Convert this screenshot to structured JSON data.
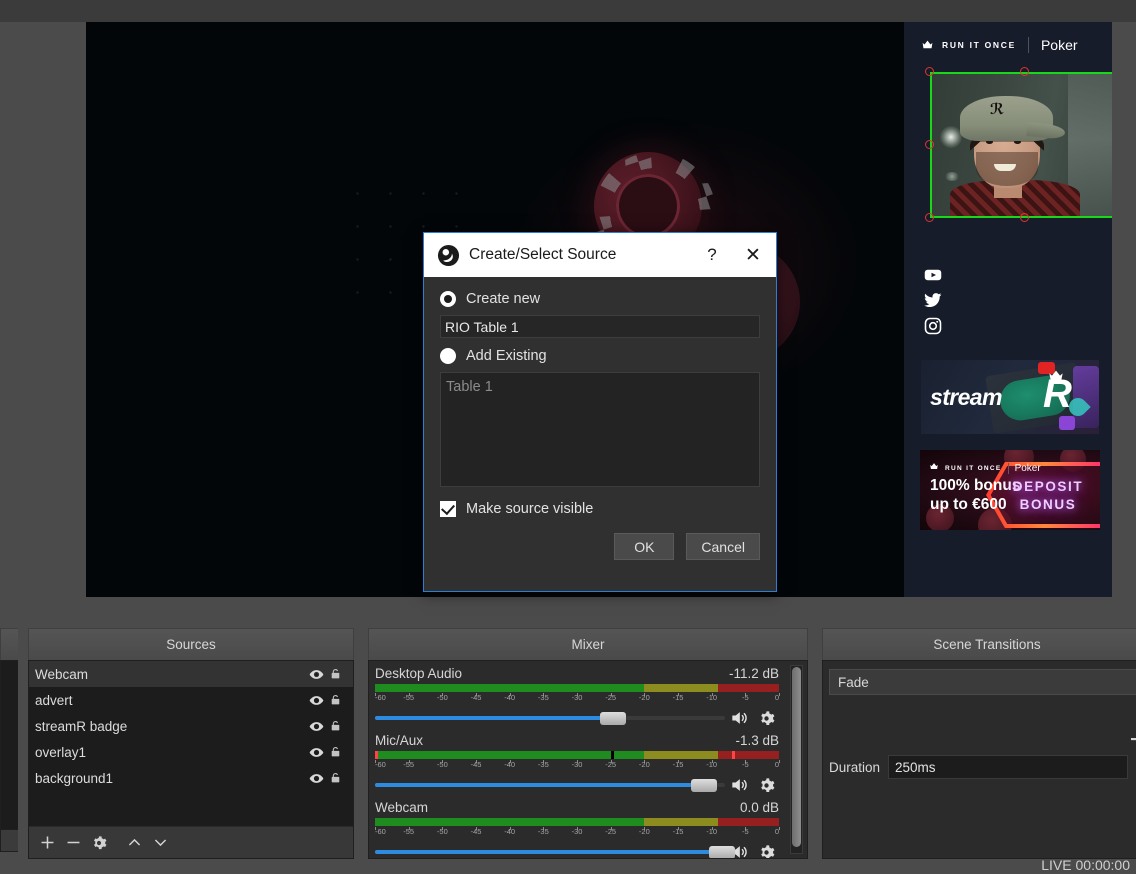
{
  "preview": {
    "overlay": {
      "brand_name": "RUN IT ONCE",
      "brand_product": "Poker",
      "social_icons": [
        "youtube-icon",
        "twitter-icon",
        "instagram-icon"
      ],
      "streamr_logo_text": "stream",
      "streamr_logo_mark": "R",
      "advert": {
        "brand_name": "RUN IT ONCE",
        "brand_product": "Poker",
        "headline_line1": "100% bonus",
        "headline_line2": "up to €600",
        "badge_line1": "DEPOSIT",
        "badge_line2": "BONUS"
      }
    },
    "selection_color": "#19d819",
    "handle_color": "#e3342f"
  },
  "dialog": {
    "title": "Create/Select Source",
    "help_label": "?",
    "close_label": "✕",
    "create_new_label": "Create new",
    "create_new_selected": true,
    "name_value": "RIO Table 1",
    "add_existing_label": "Add Existing",
    "add_existing_selected": false,
    "existing_items": [
      "Table 1"
    ],
    "make_visible_label": "Make source visible",
    "make_visible_checked": true,
    "ok_label": "OK",
    "cancel_label": "Cancel",
    "accent_color": "#2a7fd4"
  },
  "sources": {
    "title": "Sources",
    "items": [
      {
        "name": "Webcam",
        "selected": true,
        "eye": "eye-icon",
        "lock": "lock-icon"
      },
      {
        "name": "advert",
        "selected": false,
        "eye": "eye-icon",
        "lock": "lock-icon"
      },
      {
        "name": "streamR badge",
        "selected": false,
        "eye": "eye-icon",
        "lock": "lock-icon"
      },
      {
        "name": "overlay1",
        "selected": false,
        "eye": "eye-icon",
        "lock": "lock-icon"
      },
      {
        "name": "background1",
        "selected": false,
        "eye": "eye-icon",
        "lock": "lock-icon"
      }
    ],
    "toolbar": [
      {
        "icon": "plus-icon",
        "label": "+"
      },
      {
        "icon": "minus-icon",
        "label": "−"
      },
      {
        "icon": "gear-icon",
        "label": "⚙"
      },
      {
        "icon": "chevron-up-icon",
        "label": "⌃"
      },
      {
        "icon": "chevron-down-icon",
        "label": "⌄"
      }
    ]
  },
  "mixer": {
    "title": "Mixer",
    "scale": {
      "min": -60,
      "max": 0,
      "ticks": [
        -60,
        -55,
        -50,
        -45,
        -40,
        -35,
        -30,
        -25,
        -20,
        -15,
        -10,
        -5,
        0
      ]
    },
    "tracks": [
      {
        "name": "Desktop Audio",
        "db": "-11.2 dB",
        "level_db": -60,
        "active": false,
        "magnitude_db": null,
        "peak_db": null,
        "volume_pct": 68,
        "speaker_icon": "speaker-icon",
        "gear_icon": "gear-icon"
      },
      {
        "name": "Mic/Aux",
        "db": "-1.3 dB",
        "level_db": -17.0,
        "active": true,
        "magnitude_db": -25.0,
        "peak_db": -7.0,
        "volume_pct": 94,
        "speaker_icon": "speaker-icon",
        "gear_icon": "gear-icon"
      },
      {
        "name": "Webcam",
        "db": "0.0 dB",
        "level_db": -60,
        "active": false,
        "magnitude_db": null,
        "peak_db": null,
        "volume_pct": 99,
        "speaker_icon": "speaker-icon",
        "gear_icon": "gear-icon"
      }
    ]
  },
  "transitions": {
    "title": "Scene Transitions",
    "selected": "Fade",
    "add_label": "+",
    "duration_label": "Duration",
    "duration_value": "250ms"
  },
  "status": {
    "live_text": "LIVE 00:00:00"
  }
}
